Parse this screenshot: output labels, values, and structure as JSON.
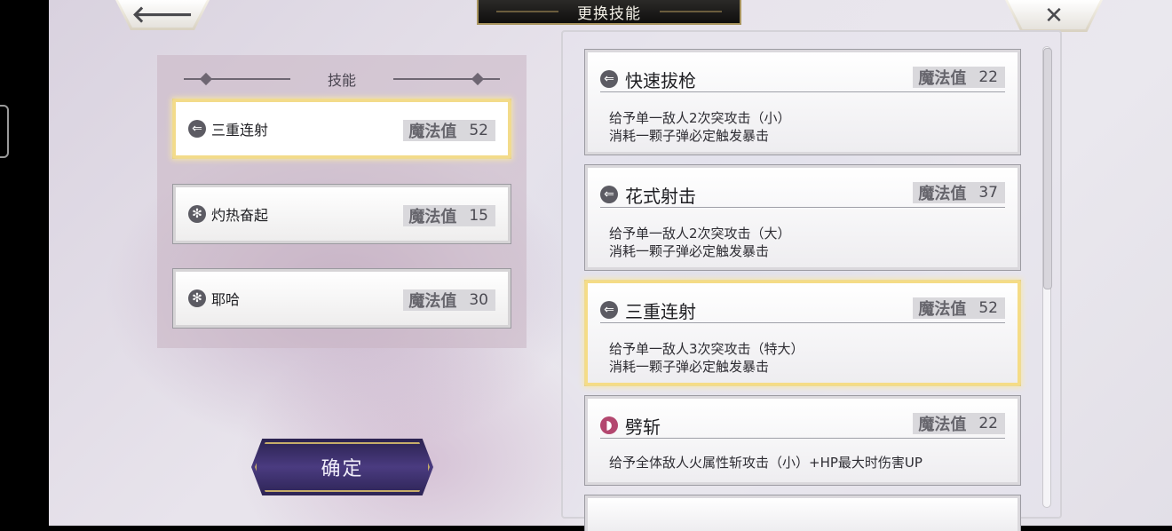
{
  "title": "更换技能",
  "top_buttons": {
    "back_glyph": "🡐",
    "close_glyph": "✕"
  },
  "equipped": {
    "header": "技能",
    "slots": [
      {
        "name": "三重连射",
        "mp_label": "魔法值",
        "mp": "52",
        "icon": "arrow-left-icon",
        "selected": true
      },
      {
        "name": "灼热奋起",
        "mp_label": "魔法值",
        "mp": "15",
        "icon": "burst-icon",
        "selected": false
      },
      {
        "name": "耶哈",
        "mp_label": "魔法值",
        "mp": "30",
        "icon": "burst-icon",
        "selected": false
      }
    ]
  },
  "confirm_label": "确定",
  "skills": [
    {
      "name": "快速拔枪",
      "mp_label": "魔法值",
      "mp": "22",
      "icon": "arrow-left-icon",
      "desc1": "给予单一敌人2次突攻击（小）",
      "desc2": "消耗一颗子弹必定触发暴击",
      "selected": false
    },
    {
      "name": "花式射击",
      "mp_label": "魔法值",
      "mp": "37",
      "icon": "arrow-left-icon",
      "desc1": "给予单一敌人2次突攻击（大）",
      "desc2": "消耗一颗子弹必定触发暴击",
      "selected": false
    },
    {
      "name": "三重连射",
      "mp_label": "魔法值",
      "mp": "52",
      "icon": "arrow-left-icon",
      "desc1": "给予单一敌人3次突攻击（特大）",
      "desc2": "消耗一颗子弹必定触发暴击",
      "selected": true
    },
    {
      "name": "劈斩",
      "mp_label": "魔法值",
      "mp": "22",
      "icon": "slash-orb-icon",
      "desc1": "给予全体敌人火属性斩攻击（小）+HP最大时伤害UP",
      "desc2": "",
      "selected": false
    }
  ],
  "colors": {
    "selected_border": "#f5dc86",
    "title_bg": "#1a1918",
    "confirm_bg": "#4a3b80"
  }
}
